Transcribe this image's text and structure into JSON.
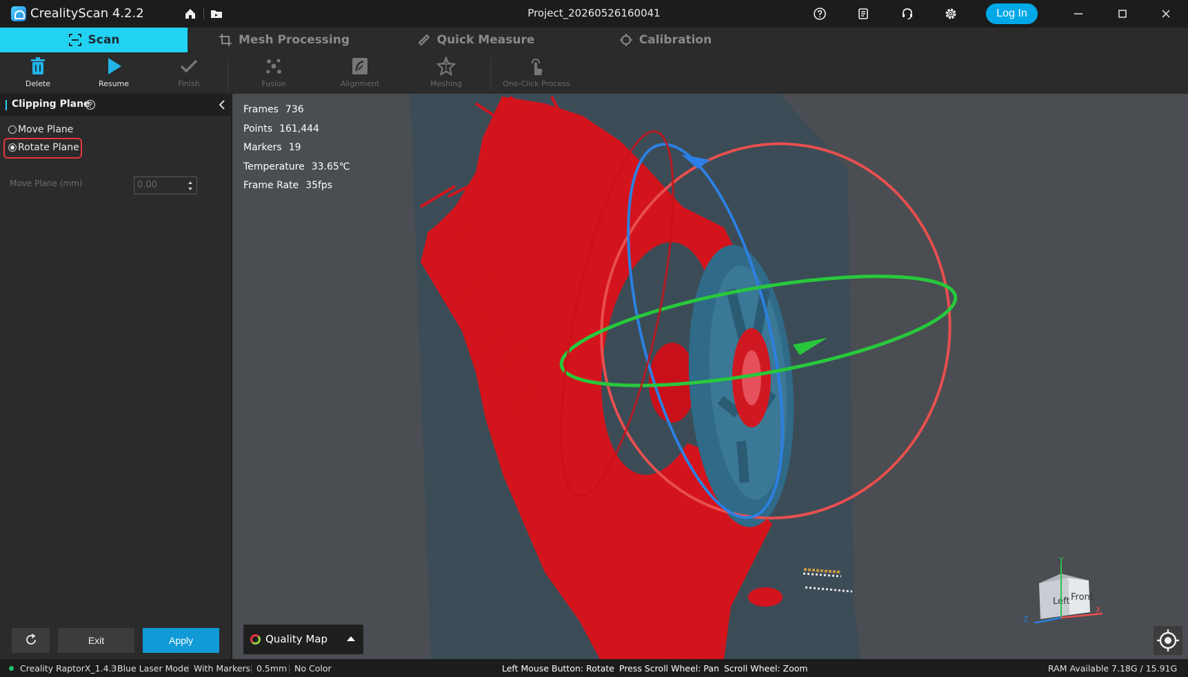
{
  "app": {
    "title": "CrealityScan 4.2.2",
    "project": "Project_20260526160041",
    "login_label": "Log In"
  },
  "tabs": [
    {
      "label": "Scan",
      "active": true
    },
    {
      "label": "Mesh Processing",
      "active": false
    },
    {
      "label": "Quick Measure",
      "active": false
    },
    {
      "label": "Calibration",
      "active": false
    }
  ],
  "toolbar": {
    "delete": "Delete",
    "resume": "Resume",
    "finish": "Finish",
    "fusion": "Fusion",
    "alignment": "Alignment",
    "meshing": "Meshing",
    "one_click": "One-Click Process"
  },
  "panel": {
    "title": "Clipping Plane",
    "move_plane": "Move Plane",
    "rotate_plane": "Rotate Plane",
    "selected": "Rotate Plane",
    "move_plane_label": "Move Plane (mm)",
    "move_plane_value": "0.00",
    "exit_label": "Exit",
    "apply_label": "Apply"
  },
  "stats": [
    {
      "key": "Frames",
      "value": "736"
    },
    {
      "key": "Points",
      "value": "161,444"
    },
    {
      "key": "Markers",
      "value": "19"
    },
    {
      "key": "Temperature",
      "value": "33.65℃"
    },
    {
      "key": "Frame Rate",
      "value": "35fps"
    }
  ],
  "viewport": {
    "quality_map_label": "Quality Map",
    "cube": {
      "left": "Left",
      "front": "Front",
      "x": "X",
      "y": "Y",
      "z": "Z"
    }
  },
  "statusbar": {
    "device": "Creality RaptorX_1.4.3",
    "mode": "Blue Laser Mode",
    "markers": "With Markers",
    "resolution": "0.5mm",
    "color": "No Color",
    "hint_rotate": "Left Mouse Button: Rotate",
    "hint_pan": "Press Scroll Wheel: Pan",
    "hint_zoom": "Scroll Wheel: Zoom",
    "ram": "RAM Available 7.18G / 15.91G"
  },
  "colors": {
    "accent": "#22d2f2",
    "apply": "#109ad6",
    "highlight": "#e8383d",
    "scan_red": "#d4141c",
    "spool": "#2f6a88"
  }
}
